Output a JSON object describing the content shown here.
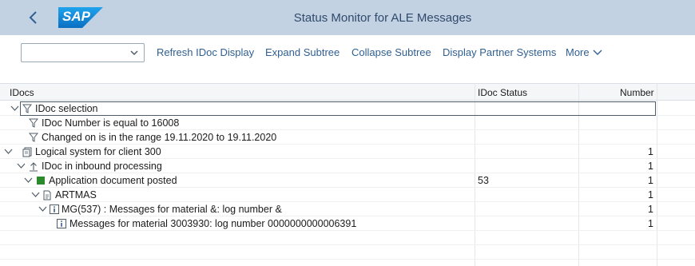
{
  "titlebar": {
    "title": "Status Monitor for ALE Messages",
    "logo_text": "SAP",
    "back_icon": "chevron-left-icon"
  },
  "toolbar": {
    "select_value": "",
    "refresh_label": "Refresh IDoc Display",
    "expand_label": "Expand Subtree",
    "collapse_label": "Collapse Subtree",
    "partner_label": "Display Partner Systems",
    "more_label": "More"
  },
  "table": {
    "headers": {
      "idocs": "IDocs",
      "status": "IDoc Status",
      "number": "Number"
    },
    "rows": [
      {
        "label": "IDoc selection",
        "status": "",
        "number": ""
      },
      {
        "label": "IDoc Number is equal to 16008",
        "status": "",
        "number": ""
      },
      {
        "label": "Changed on is in the range 19.11.2020 to 19.11.2020",
        "status": "",
        "number": ""
      },
      {
        "label": "Logical system for client 300",
        "status": "",
        "number": "1"
      },
      {
        "label": "IDoc in inbound processing",
        "status": "",
        "number": "1"
      },
      {
        "label": "Application document posted",
        "status": "53",
        "number": "1"
      },
      {
        "label": "ARTMAS",
        "status": "",
        "number": "1"
      },
      {
        "label": "MG(537) : Messages for material &: log number &",
        "status": "",
        "number": "1"
      },
      {
        "label": "Messages for material 3003930: log number 0000000000006391",
        "status": "",
        "number": "1"
      }
    ]
  },
  "colors": {
    "titlebar_bg": "#c3d2e3",
    "logo_blue": "#1a8fd9",
    "link_blue": "#2f5f93",
    "status_green": "#2b8a2b"
  }
}
